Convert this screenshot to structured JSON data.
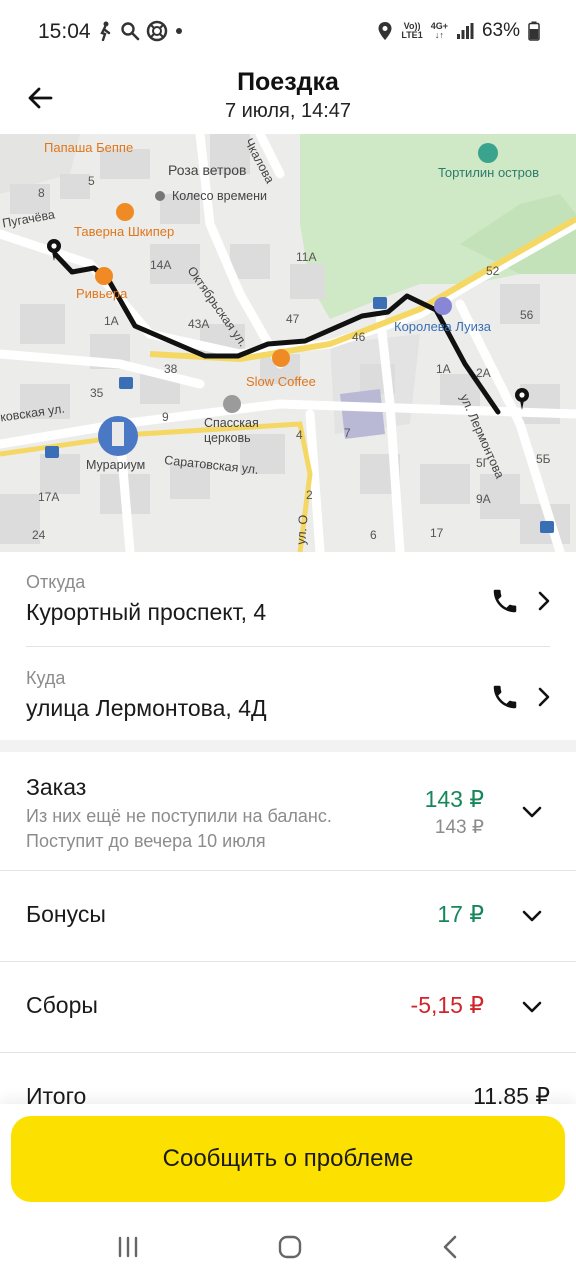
{
  "status_bar": {
    "time": "15:04",
    "battery": "63%",
    "network_top": "Vo))",
    "network_bottom": "LTE1",
    "net_type_top": "4G+",
    "net_type_bottom": "↓↑",
    "icons": [
      "walk-icon",
      "search-icon",
      "lifebuoy-icon",
      "dot-icon",
      "location-icon",
      "signal-icon",
      "battery-icon"
    ]
  },
  "header": {
    "title": "Поездка",
    "subtitle": "7 июля, 14:47"
  },
  "map": {
    "labels": {
      "papasha": "Папаша Беппе",
      "roza": "Роза ветров",
      "koleso": "Колесо времени",
      "tortilin": "Тортилин остров",
      "pugacheva": "Пугачёва",
      "taverna": "Таверна Шкипер",
      "river": "Ривьера",
      "oktyabrskaya": "Октябрьская ул.",
      "chkalova": "Чкалова",
      "koroleva": "Королева Луиза",
      "slow": "Slow Coffee",
      "spasskaya": "Спасская церковь",
      "murarium": "Мурариум",
      "saratovskaya": "Саратовская ул.",
      "moskovskaya": "ковская ул.",
      "lermontova": "ул. Лермонтова",
      "uo": "ул. О",
      "n8": "8",
      "n5": "5",
      "n14a": "14А",
      "n11a": "11А",
      "n52": "52",
      "n56": "56",
      "n43a": "43А",
      "n47": "47",
      "n46": "46",
      "n38": "38",
      "n35": "35",
      "n1a": "1А",
      "n2a": "2А",
      "n9": "9",
      "n4": "4",
      "n7": "7",
      "n5g": "5Г",
      "n5b": "5Б",
      "n9a": "9А",
      "n17a": "17А",
      "n24": "24",
      "n17": "17",
      "n2": "2",
      "n6": "6",
      "n1a2": "1А"
    }
  },
  "trip": {
    "from_label": "Откуда",
    "from_value": "Курортный проспект, 4",
    "to_label": "Куда",
    "to_value": "улица Лермонтова, 4Д"
  },
  "finance": {
    "order_title": "Заказ",
    "order_note_1": "Из них ещё не поступили на баланс.",
    "order_note_2": "Поступит до вечера 10 июля",
    "order_amount": "143 ₽",
    "order_pending": "143 ₽",
    "bonus_title": "Бонусы",
    "bonus_amount": "17 ₽",
    "fees_title": "Сборы",
    "fees_amount": "-5,15 ₽",
    "total_title": "Итого",
    "total_amount": "11,85 ₽"
  },
  "actions": {
    "report_label": "Сообщить о проблеме"
  },
  "colors": {
    "accent_yellow": "#fce000",
    "positive_green": "#16875a",
    "negative_red": "#d0262b"
  }
}
